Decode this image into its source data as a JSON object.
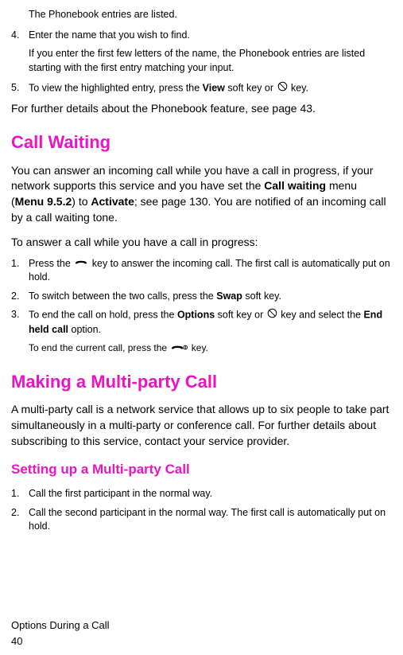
{
  "top": {
    "phonebook_listed": "The Phonebook entries are listed.",
    "step4_num": "4.",
    "step4_text": "Enter the name that you wish to find.",
    "step4_note": "If you enter the first few letters of the name, the Phonebook entries are listed starting with the first entry matching your input.",
    "step5_num": "5.",
    "step5_text_a": "To view the highlighted entry, press the ",
    "step5_bold": "View",
    "step5_text_b": " soft key or ",
    "step5_text_c": " key.",
    "details": "For further details about the Phonebook feature, see page 43."
  },
  "call_waiting": {
    "title": "Call Waiting",
    "para_a": "You can answer an incoming call while you have a call in progress, if your network supports this service and you have set the ",
    "para_b1": "Call waiting",
    "para_c": " menu (",
    "para_b2": "Menu 9.5.2",
    "para_d": ") to ",
    "para_b3": "Activate",
    "para_e": "; see page 130. You are notified of an incoming call by a call waiting tone.",
    "intro": "To answer a call while you have a call in progress:",
    "s1_num": "1.",
    "s1_a": "Press the ",
    "s1_b": " key to answer the incoming call. The first call is automatically put on hold.",
    "s2_num": "2.",
    "s2_a": "To switch between the two calls, press the ",
    "s2_bold": "Swap",
    "s2_b": " soft key.",
    "s3_num": "3.",
    "s3_a": "To end the call on hold, press the ",
    "s3_bold1": "Options",
    "s3_b": " soft key or ",
    "s3_c": " key and select the ",
    "s3_bold2": "End held call",
    "s3_d": " option.",
    "s3_note_a": "To end the current call, press the ",
    "s3_note_b": " key."
  },
  "multiparty": {
    "title": "Making a Multi-party Call",
    "para": "A multi-party call is a network service that allows up to six people to take part simultaneously in a multi-party or conference call. For further details about subscribing to this service, contact your service provider.",
    "subtitle": "Setting up a Multi-party Call",
    "s1_num": "1.",
    "s1": "Call the first participant in the normal way.",
    "s2_num": "2.",
    "s2": "Call the second participant in the normal way. The first call is automatically put on hold."
  },
  "footer": {
    "section": "Options During a Call",
    "page": "40"
  }
}
